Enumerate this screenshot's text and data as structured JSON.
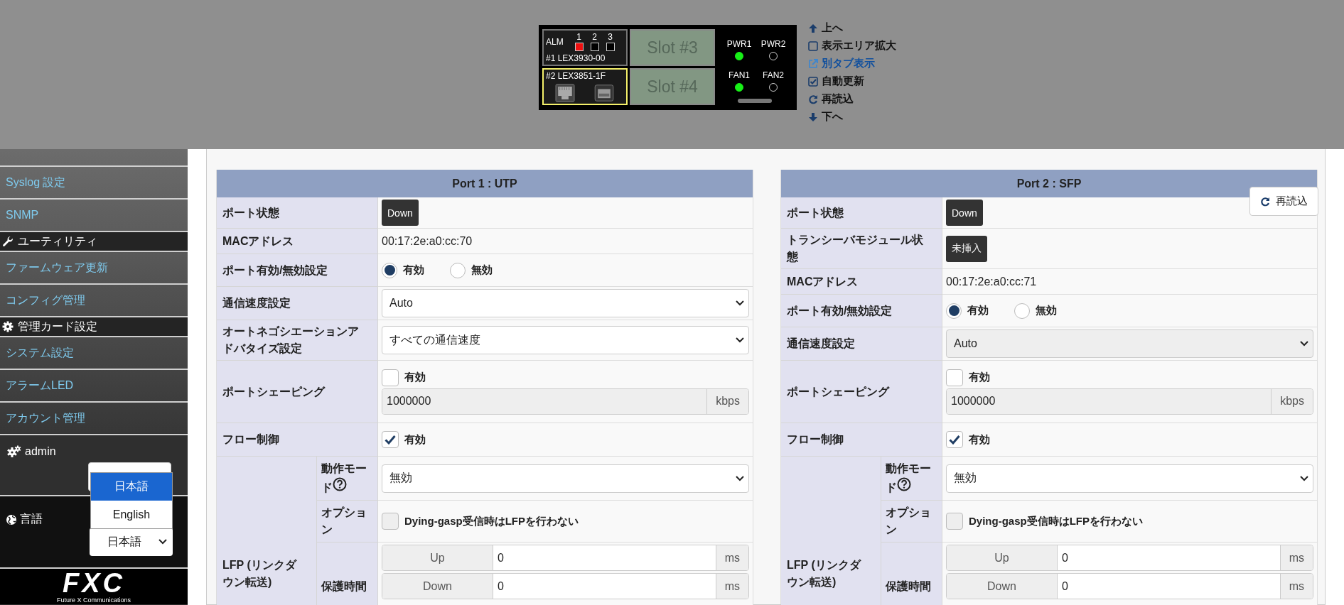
{
  "device_panel": {
    "alarm": {
      "label": "ALM",
      "leds": [
        {
          "label": "1",
          "on": true
        },
        {
          "label": "2",
          "on": false
        },
        {
          "label": "3",
          "on": false
        }
      ]
    },
    "slots": [
      {
        "label": "#1 LEX3930-00",
        "selected": false
      },
      {
        "label": "#2 LEX3851-1F",
        "selected": true
      }
    ],
    "empty_slots": [
      "Slot #3",
      "Slot #4"
    ],
    "status_leds": [
      {
        "label": "PWR1",
        "on": true
      },
      {
        "label": "PWR2",
        "on": false
      },
      {
        "label": "FAN1",
        "on": true
      },
      {
        "label": "FAN2",
        "on": false
      }
    ]
  },
  "view_links": [
    {
      "kind": "up",
      "label": "上へ"
    },
    {
      "kind": "checkbox",
      "label": "表示エリア拡大",
      "checked": false
    },
    {
      "kind": "link",
      "label": "別タブ表示"
    },
    {
      "kind": "checkbox",
      "label": "自動更新",
      "checked": true
    },
    {
      "kind": "reload",
      "label": "再読込"
    },
    {
      "kind": "down",
      "label": "下へ"
    }
  ],
  "sidebar": {
    "sections": [
      {
        "items": [
          "Syslog 設定",
          "SNMP"
        ]
      },
      {
        "kind": "wrench",
        "header": "ユーティリティ",
        "items": [
          "ファームウェア更新",
          "コンフィグ管理"
        ]
      },
      {
        "kind": "gear",
        "header": "管理カード設定",
        "items": [
          "システム設定",
          "アラームLED",
          "アカウント管理"
        ]
      }
    ],
    "user": {
      "name": "admin"
    },
    "language": {
      "label": "言語",
      "value": "日本語",
      "options": [
        {
          "label": "日本語",
          "selected": true
        },
        {
          "label": "English",
          "selected": false
        }
      ]
    },
    "logo": {
      "name": "FXC",
      "tagline": "Future X Communications"
    }
  },
  "reload_button": "再読込",
  "ports": [
    {
      "title": "Port 1 : UTP",
      "rows": [
        {
          "kind": "status",
          "label": "ポート状態",
          "value": "Down"
        },
        {
          "kind": "text",
          "label": "MACアドレス",
          "value": "00:17:2e:a0:cc:70"
        },
        {
          "kind": "radio",
          "label": "ポート有効/無効設定",
          "options": [
            {
              "label": "有効",
              "selected": true
            },
            {
              "label": "無効",
              "selected": false
            }
          ]
        },
        {
          "kind": "select",
          "label": "通信速度設定",
          "value": "Auto",
          "disabled": false
        },
        {
          "kind": "select",
          "label": "オートネゴシエーションアドバタイズ設定",
          "value": "すべての通信速度",
          "disabled": false
        },
        {
          "kind": "shaping",
          "label": "ポートシェーピング",
          "option": "有効",
          "checked": false,
          "value": "1000000",
          "unit": "kbps"
        },
        {
          "kind": "checkbox",
          "label": "フロー制御",
          "option": "有効",
          "checked": true,
          "disabled": false
        },
        {
          "kind": "group",
          "label": "LFP (リンクダウン転送)",
          "children": [
            {
              "kind": "select",
              "label": "動作モード",
              "help": true,
              "value": "無効",
              "disabled": false
            },
            {
              "kind": "checkbox",
              "label": "オプション",
              "option": "Dying-gasp受信時はLFPを行わない",
              "checked": false,
              "disabled": true
            },
            {
              "kind": "timer",
              "label": "保護時間",
              "fields": [
                {
                  "label": "Up",
                  "value": "0",
                  "unit": "ms"
                },
                {
                  "label": "Down",
                  "value": "0",
                  "unit": "ms"
                }
              ]
            }
          ]
        }
      ]
    },
    {
      "title": "Port 2 : SFP",
      "rows": [
        {
          "kind": "status",
          "label": "ポート状態",
          "value": "Down"
        },
        {
          "kind": "status",
          "label": "トランシーバモジュール状態",
          "value": "未挿入"
        },
        {
          "kind": "text",
          "label": "MACアドレス",
          "value": "00:17:2e:a0:cc:71"
        },
        {
          "kind": "radio",
          "label": "ポート有効/無効設定",
          "options": [
            {
              "label": "有効",
              "selected": true
            },
            {
              "label": "無効",
              "selected": false
            }
          ]
        },
        {
          "kind": "select",
          "label": "通信速度設定",
          "value": "Auto",
          "disabled": true
        },
        {
          "kind": "shaping",
          "label": "ポートシェーピング",
          "option": "有効",
          "checked": false,
          "value": "1000000",
          "unit": "kbps"
        },
        {
          "kind": "checkbox",
          "label": "フロー制御",
          "option": "有効",
          "checked": true,
          "disabled": false
        },
        {
          "kind": "group",
          "label": "LFP (リンクダウン転送)",
          "children": [
            {
              "kind": "select",
              "label": "動作モード",
              "help": true,
              "value": "無効",
              "disabled": false
            },
            {
              "kind": "checkbox",
              "label": "オプション",
              "option": "Dying-gasp受信時はLFPを行わない",
              "checked": false,
              "disabled": true
            },
            {
              "kind": "timer",
              "label": "保護時間",
              "fields": [
                {
                  "label": "Up",
                  "value": "0",
                  "unit": "ms"
                },
                {
                  "label": "Down",
                  "value": "0",
                  "unit": "ms"
                }
              ]
            }
          ]
        }
      ]
    }
  ]
}
